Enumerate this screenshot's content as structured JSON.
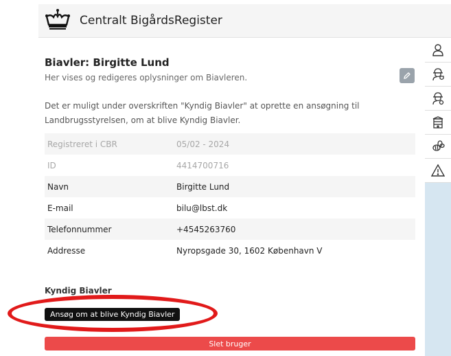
{
  "app": {
    "title": "Centralt BigårdsRegister"
  },
  "rail": {
    "icons": [
      "user-icon",
      "beekeeper-shield-icon",
      "beekeeper-gear-icon",
      "beehive-icon",
      "bee-icon",
      "warning-icon"
    ]
  },
  "page": {
    "heading": "Biavler: Birgitte Lund",
    "subheading": "Her vises og redigeres oplysninger om Biavleren.",
    "info": "Det er muligt under overskriften \"Kyndig Biavler\" at oprette en ansøgning til Landbrugsstyrelsen, om at blive Kyndig Biavler."
  },
  "details": {
    "rows": [
      {
        "label": "Registreret i CBR",
        "value": "05/02 - 2024"
      },
      {
        "label": "ID",
        "value": "4414700716"
      },
      {
        "label": "Navn",
        "value": "Birgitte Lund"
      },
      {
        "label": "E-mail",
        "value": "bilu@lbst.dk"
      },
      {
        "label": "Telefonnummer",
        "value": "+4545263760"
      },
      {
        "label": "Addresse",
        "value": "Nyropsgade 30, 1602 København V"
      }
    ]
  },
  "kyndig": {
    "label": "Kyndig Biavler",
    "button": "Ansøg om at blive Kyndig Biavler"
  },
  "delete": {
    "button": "Slet bruger"
  },
  "colors": {
    "delete": "#ec4a4a",
    "highlight": "#e11a1a",
    "rail": "#d6e6f1"
  }
}
